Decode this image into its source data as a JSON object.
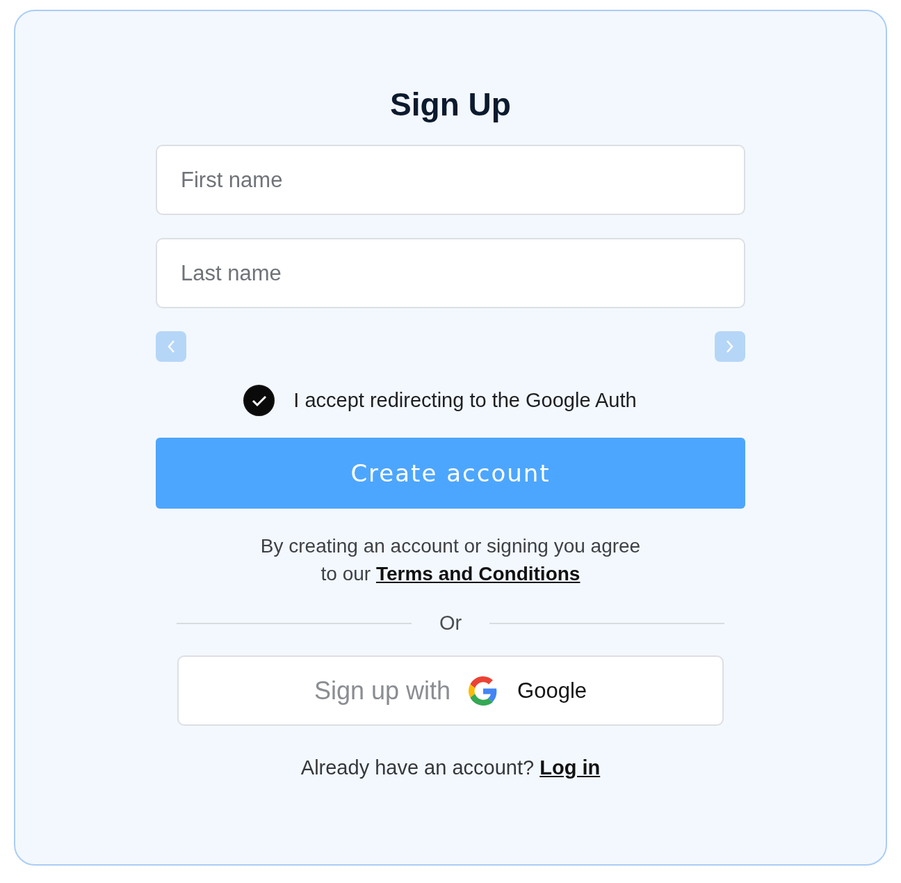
{
  "title": "Sign Up",
  "fields": [
    {
      "placeholder": "First name"
    },
    {
      "placeholder": "Last name"
    }
  ],
  "consent": {
    "label": "I accept redirecting to the Google Auth",
    "checked": true
  },
  "create_button": "Create account",
  "terms": {
    "text": "By creating an account or signing you agree to our",
    "link": "Terms and Conditions"
  },
  "divider": "Or",
  "google_button": {
    "prefix": "Sign up with",
    "brand": "Google"
  },
  "login": {
    "text": "Already have an account?",
    "link": "Log in"
  }
}
